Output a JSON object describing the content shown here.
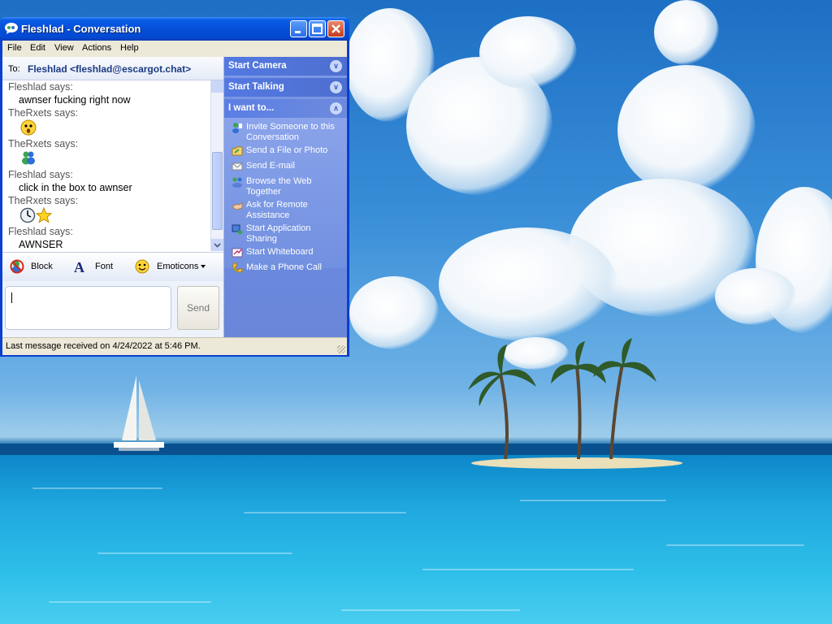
{
  "window": {
    "title": "Fleshlad - Conversation",
    "menu": [
      "File",
      "Edit",
      "View",
      "Actions",
      "Help"
    ]
  },
  "conversation": {
    "to_label": "To:",
    "to_contact": "Fleshlad <fleshlad@escargot.chat>",
    "messages": [
      {
        "sender": "Fleshlad says:",
        "text": "awnser fucking right now"
      },
      {
        "sender": "TheRxets says:",
        "text": "",
        "emoticon": "surprised-emoticon"
      },
      {
        "sender": "TheRxets says:",
        "text": "",
        "emoticon": "msn-buddy-emoticon"
      },
      {
        "sender": "Fleshlad says:",
        "text": "click in the box to awnser"
      },
      {
        "sender": "TheRxets says:",
        "text": "",
        "emoticon": "clock-and-star-emoticons"
      },
      {
        "sender": "Fleshlad says:",
        "text": "AWNSER"
      }
    ]
  },
  "toolbar": {
    "block": "Block",
    "font": "Font",
    "emoticons": "Emoticons"
  },
  "compose": {
    "send": "Send"
  },
  "taskpane": {
    "start_camera": "Start Camera",
    "start_talking": "Start Talking",
    "i_want_to": "I want to...",
    "tasks": [
      {
        "label": "Invite Someone to this Conversation",
        "icon": "invite-icon"
      },
      {
        "label": "Send a File or Photo",
        "icon": "folder-icon"
      },
      {
        "label": "Send E-mail",
        "icon": "envelope-icon"
      },
      {
        "label": "Browse the Web Together",
        "icon": "web-browse-icon"
      },
      {
        "label": "Ask for Remote Assistance",
        "icon": "remote-assistance-icon"
      },
      {
        "label": "Start Application Sharing",
        "icon": "app-sharing-icon"
      },
      {
        "label": "Start Whiteboard",
        "icon": "whiteboard-icon"
      },
      {
        "label": "Make a Phone Call",
        "icon": "phone-icon"
      }
    ]
  },
  "status": {
    "text": "Last message received on 4/24/2022 at 5:46 PM."
  },
  "colors": {
    "titlebar": "#0450d8",
    "taskpane": "#6b8bde",
    "desktop_sky": "#3a8fd8",
    "desktop_sea": "#1fa7de"
  }
}
